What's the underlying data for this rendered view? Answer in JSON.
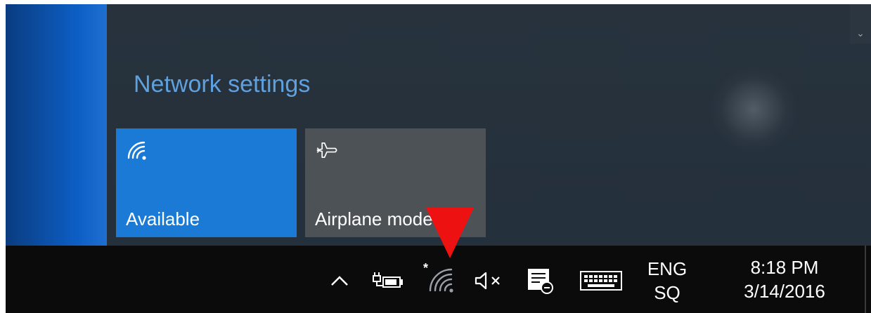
{
  "flyout": {
    "network_settings_label": "Network settings",
    "tiles": [
      {
        "label": "Available",
        "icon": "wifi-icon",
        "state": "on",
        "color": "#1a7ad6"
      },
      {
        "label": "Airplane mode",
        "icon": "airplane-icon",
        "state": "off",
        "color": "#4d5256"
      }
    ],
    "accent_color": "#5fa0de"
  },
  "taskbar": {
    "tray_icons": [
      "show-hidden-icons-caret",
      "power-battery-icon",
      "network-wifi-icon",
      "volume-muted-icon",
      "action-center-icon",
      "touch-keyboard-icon"
    ],
    "language_line1": "ENG",
    "language_line2": "SQ",
    "time": "8:18 PM",
    "date": "3/14/2016"
  },
  "annotation": {
    "arrow_color": "#ee1111",
    "icon": "red-arrow-pointer"
  }
}
